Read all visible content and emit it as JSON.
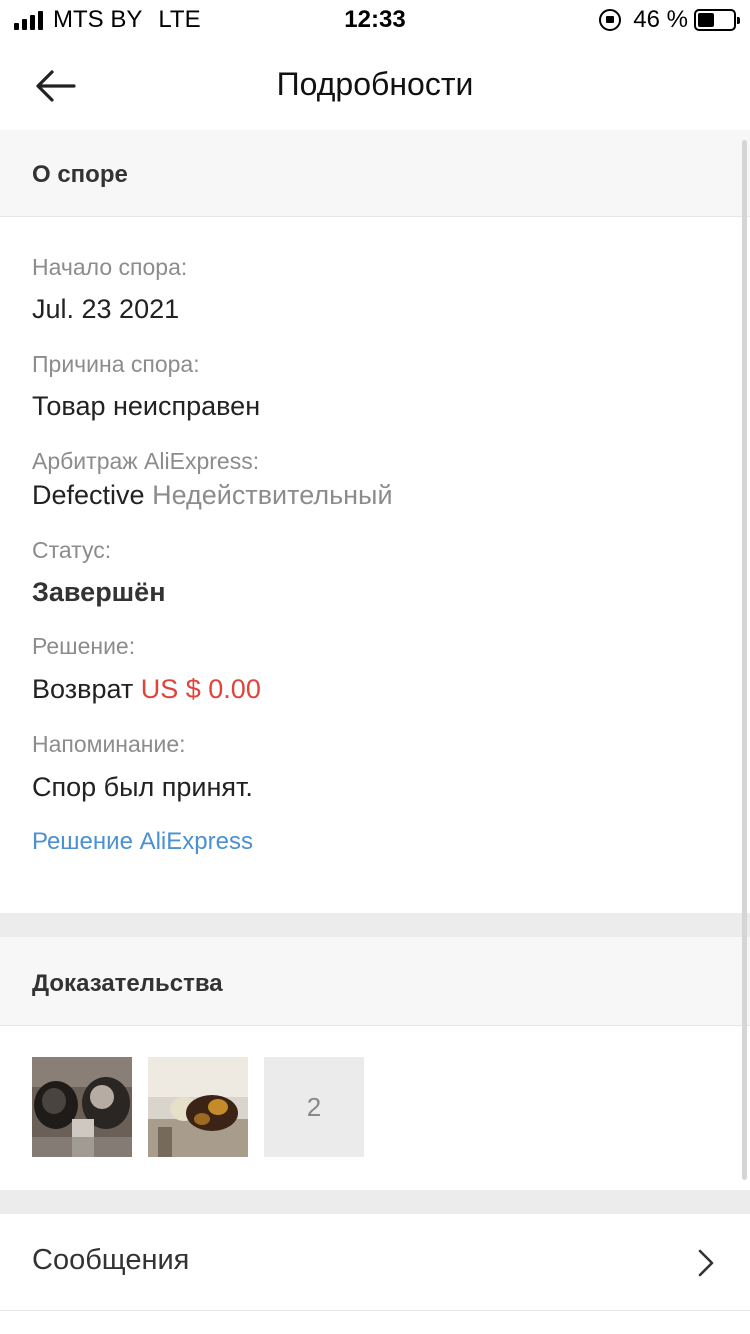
{
  "status_bar": {
    "carrier": "MTS BY",
    "network": "LTE",
    "time": "12:33",
    "battery_percent": "46 %",
    "battery_level": 0.46
  },
  "header": {
    "title": "Подробности",
    "back_icon": "arrow-left-icon"
  },
  "dispute_section": {
    "title": "О споре",
    "start_label": "Начало спора:",
    "start_value": "Jul. 23 2021",
    "reason_label": "Причина спора:",
    "reason_value": "Товар неисправен",
    "arbitration_label": "Арбитраж AliExpress:",
    "arbitration_value": "Defective",
    "arbitration_note": "Недействительный",
    "status_label": "Статус:",
    "status_value": "Завершён",
    "decision_label": "Решение:",
    "decision_value": "Возврат",
    "decision_amount": "US $ 0.00",
    "reminder_label": "Напоминание:",
    "reminder_value": "Спор был принят.",
    "decision_link": "Решение AliExpress"
  },
  "evidence_section": {
    "title": "Доказательства",
    "more_count": "2"
  },
  "messages": {
    "label": "Сообщения",
    "chevron_icon": "chevron-right-icon"
  },
  "colors": {
    "accent_red": "#e0433a",
    "link_blue": "#4a90d2"
  }
}
